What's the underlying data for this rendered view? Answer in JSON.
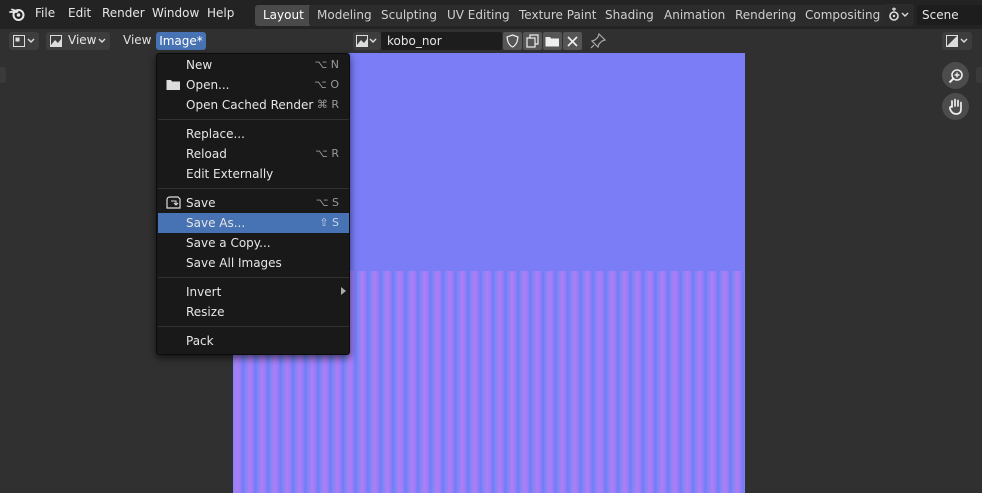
{
  "topbar": {
    "menus": [
      "File",
      "Edit",
      "Render",
      "Window",
      "Help"
    ],
    "workspaces": [
      "Layout",
      "Modeling",
      "Sculpting",
      "UV Editing",
      "Texture Paint",
      "Shading",
      "Animation",
      "Rendering",
      "Compositing"
    ],
    "active_workspace": "Layout",
    "scene": "Scene"
  },
  "header": {
    "view_dropdown": "View",
    "view_menu": "View",
    "image_menu": "Image*",
    "image_name": "kobo_nor"
  },
  "dropdown": {
    "items": [
      {
        "label": "New",
        "shortcut": "⌥ N"
      },
      {
        "label": "Open...",
        "shortcut": "⌥ O"
      },
      {
        "label": "Open Cached Render",
        "shortcut": "⌘ R"
      },
      {
        "label": "Replace...",
        "shortcut": ""
      },
      {
        "label": "Reload",
        "shortcut": "⌥ R"
      },
      {
        "label": "Edit Externally",
        "shortcut": ""
      },
      {
        "label": "Save",
        "shortcut": "⌥ S"
      },
      {
        "label": "Save As...",
        "shortcut": "⇧ S"
      },
      {
        "label": "Save a Copy...",
        "shortcut": ""
      },
      {
        "label": "Save All Images",
        "shortcut": ""
      },
      {
        "label": "Invert",
        "shortcut": ""
      },
      {
        "label": "Resize",
        "shortcut": ""
      },
      {
        "label": "Pack",
        "shortcut": ""
      }
    ],
    "highlighted": "Save As..."
  },
  "colors": {
    "accent": "#4772b3",
    "background": "#303030",
    "menu_background": "#191919",
    "normal_map_blue": "#7a7df6"
  }
}
